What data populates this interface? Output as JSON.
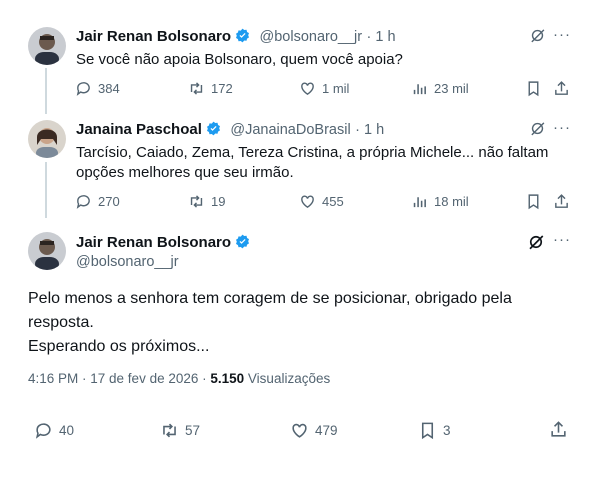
{
  "tweet1": {
    "name": "Jair Renan Bolsonaro",
    "handle": "@bolsonaro__jr",
    "time": "· 1 h",
    "text": "Se você não apoia Bolsonaro, quem você apoia?",
    "replies": "384",
    "retweets": "172",
    "likes": "1 mil",
    "views": "23 mil"
  },
  "tweet2": {
    "name": "Janaina Paschoal",
    "handle": "@JanainaDoBrasil",
    "time": "· 1 h",
    "text_line1": "Tarcísio, Caiado, Zema, Tereza Cristina, a própria Michele... não faltam",
    "text_line2": "opções melhores que seu irmão.",
    "replies": "270",
    "retweets": "19",
    "likes": "455",
    "views": "18 mil"
  },
  "tweet3": {
    "name": "Jair Renan Bolsonaro",
    "handle": "@bolsonaro__jr",
    "text_line1": "Pelo menos a senhora tem coragem de se posicionar, obrigado pela",
    "text_line2": "resposta.",
    "text_line3": "Esperando os próximos...",
    "timestamp": "4:16 PM · 17 de fev de 2026 · ",
    "views_count": "5.150",
    "views_label": " Visualizações",
    "replies": "40",
    "retweets": "57",
    "likes": "479",
    "bookmarks": "3"
  },
  "colors": {
    "verified": "#1d9bf0",
    "muted": "#536471",
    "text": "#0f1419"
  }
}
